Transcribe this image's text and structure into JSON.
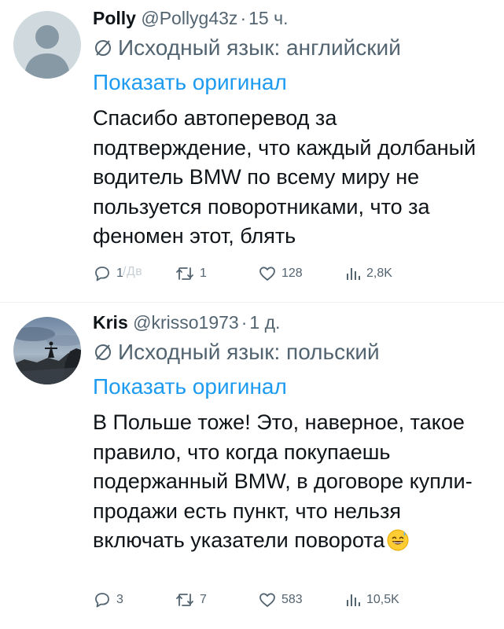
{
  "tweets": [
    {
      "author": "Polly",
      "handle": "@Pollyg43z",
      "separator": "·",
      "time": "15 ч.",
      "translated_from": "Исходный язык: английский",
      "show_original": "Показать оригинал",
      "text": "Спасибо автоперевод за подтверждение, что каждый долбаный водитель BMW по всему миру не пользуется поворотниками, что за феномен этот, блять",
      "replies": "1",
      "retweets": "1",
      "likes": "128",
      "views": "2,8K",
      "avatar_icon": "default-avatar-icon",
      "watermark": "/Дв"
    },
    {
      "author": "Kris",
      "handle": "@krisso1973",
      "separator": "·",
      "time": "1 д.",
      "translated_from": "Исходный язык: польский",
      "show_original": "Показать оригинал",
      "text": "В Польше тоже! Это, наверное, такое правило, что когда покупаешь подержанный BMW, в договоре купли-продажи есть пункт, что нельзя включать указатели поворота",
      "emoji": "sweat-smile-emoji-icon",
      "replies": "3",
      "retweets": "7",
      "likes": "583",
      "views": "10,5K",
      "avatar_icon": "landscape-photo-avatar"
    }
  ],
  "colors": {
    "text": "#0f1419",
    "secondary": "#536471",
    "link": "#1d9bf0",
    "divider": "#eff3f4"
  }
}
